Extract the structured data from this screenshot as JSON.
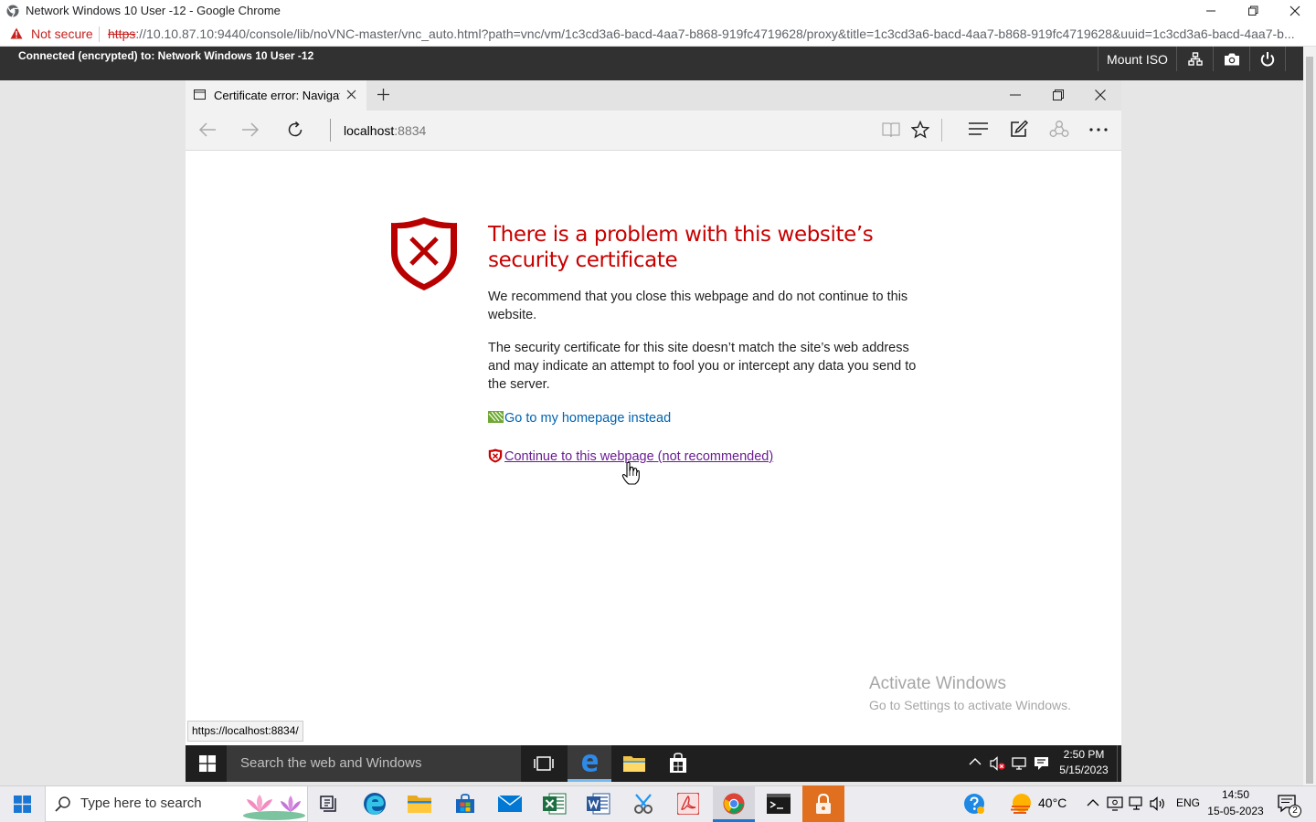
{
  "chrome": {
    "title": "Network Windows 10 User -12 - Google Chrome",
    "not_secure": "Not secure",
    "url_scheme": "https",
    "url_rest": "://10.10.87.10:9440/console/lib/noVNC-master/vnc_auto.html?path=vnc/vm/1c3cd3a6-bacd-4aa7-b868-919fc4719628/proxy&title=1c3cd3a6-bacd-4aa7-b868-919fc4719628&uuid=1c3cd3a6-bacd-4aa7-b..."
  },
  "novnc": {
    "status": "Connected (encrypted) to: Network Windows 10 User -12",
    "mount_iso": "Mount ISO"
  },
  "edge": {
    "tab_title": "Certificate error: Navigat",
    "address_host": "localhost",
    "address_port": ":8834"
  },
  "error_page": {
    "title": "There is a problem with this website’s security certificate",
    "para1": "We recommend that you close this webpage and do not continue to this website.",
    "para2": "The security certificate for this site doesn’t match the site’s web address and may indicate an attempt to fool you or intercept any data you send to the server.",
    "homepage_link": "Go to my homepage instead",
    "continue_link": "Continue to this webpage (not recommended)"
  },
  "watermark": {
    "title": "Activate Windows",
    "subtitle": "Go to Settings to activate Windows."
  },
  "status_url": "https://localhost:8834/",
  "inner_taskbar": {
    "search_placeholder": "Search the web and Windows",
    "time": "2:50 PM",
    "date": "5/15/2023"
  },
  "host_taskbar": {
    "search_placeholder": "Type here to search",
    "weather": "40°C",
    "language": "ENG",
    "time": "14:50",
    "date": "15-05-2023",
    "notification_count": "2"
  },
  "colors": {
    "error_red": "#c80000",
    "link_blue": "#0063b1",
    "visited_purple": "#6b1d93",
    "novnc_bar": "#313131"
  }
}
